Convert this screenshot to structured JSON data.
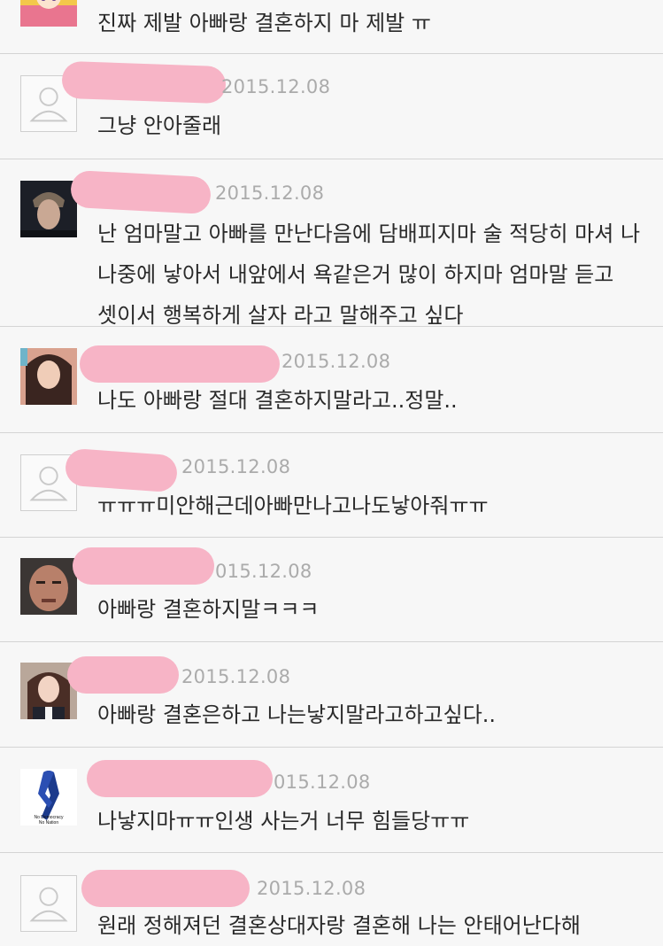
{
  "comments": [
    {
      "avatar": "sailor-girl-avatar",
      "date": "",
      "text": "진짜 제발 아빠랑 결혼하지 마 제발 ㅠ"
    },
    {
      "avatar": "default-user-icon",
      "date": "2015.12.08",
      "text": "그냥 안아줄래"
    },
    {
      "avatar": "dark-hair-man-photo",
      "date": "2015.12.08",
      "text": "난 엄마말고 아빠를 만난다음에 담배피지마 술 적당히 마셔 나 나중에 낳아서 내앞에서 욕같은거 많이 하지마 엄마말 듣고 셋이서 행복하게 살자 라고 말해주고 싶다"
    },
    {
      "avatar": "girl-photo",
      "date": "2015.12.08",
      "text": "나도 아빠랑 절대 결혼하지말라고..정말.."
    },
    {
      "avatar": "default-user-icon",
      "date": "2015.12.08",
      "text": "ㅠㅠㅠ미안해근데아빠만나고나도낳아줘ㅠㅠ"
    },
    {
      "avatar": "angry-man-photo",
      "date": "015.12.08",
      "text": "아빠랑 결혼하지말ㅋㅋㅋ"
    },
    {
      "avatar": "schoolgirl-photo",
      "date": "2015.12.08",
      "text": "아빠랑 결혼은하고 나는낳지말라고하고싶다.."
    },
    {
      "avatar": "ribbon-logo",
      "date": "015.12.08",
      "text": "나낳지마ㅠㅠ인생 사는거 너무 힘들당ㅠㅠ"
    },
    {
      "avatar": "default-user-icon",
      "date": "2015.12.08",
      "text": "원래 정해져던 결혼상대자랑 결혼해 나는 안태어난다해"
    }
  ],
  "ribbon_logo_text": "No Democracy No Nation",
  "colors": {
    "redaction": "#f7b4c6",
    "date": "#ababab",
    "text": "#2a2a2a",
    "divider": "#d4d4d4"
  }
}
